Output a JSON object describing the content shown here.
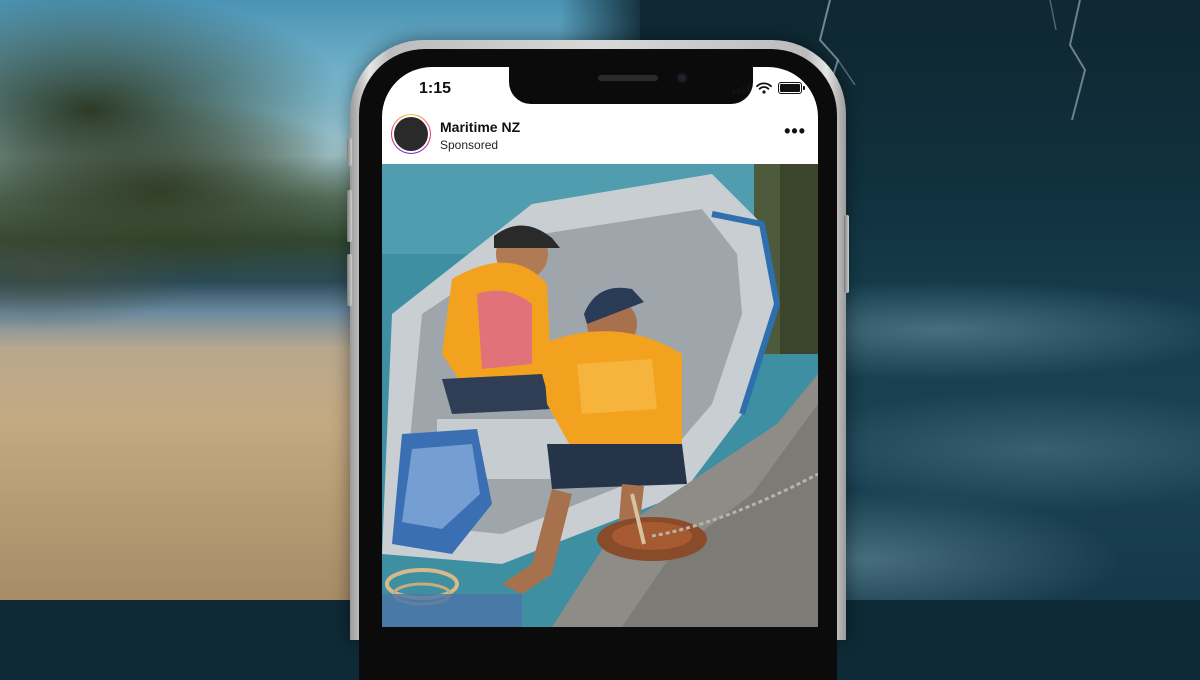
{
  "status_bar": {
    "time": "1:15"
  },
  "post": {
    "account_name": "Maritime NZ",
    "label": "Sponsored",
    "more_icon": "ellipsis-icon"
  },
  "icons": [
    "signal-icon",
    "wifi-icon",
    "battery-icon",
    "ellipsis-icon"
  ],
  "colors": {
    "life_jacket": "#f2a21e",
    "water": "#3f8fa3",
    "boat_hull": "#c8ced2",
    "screen": "#ffffff"
  }
}
